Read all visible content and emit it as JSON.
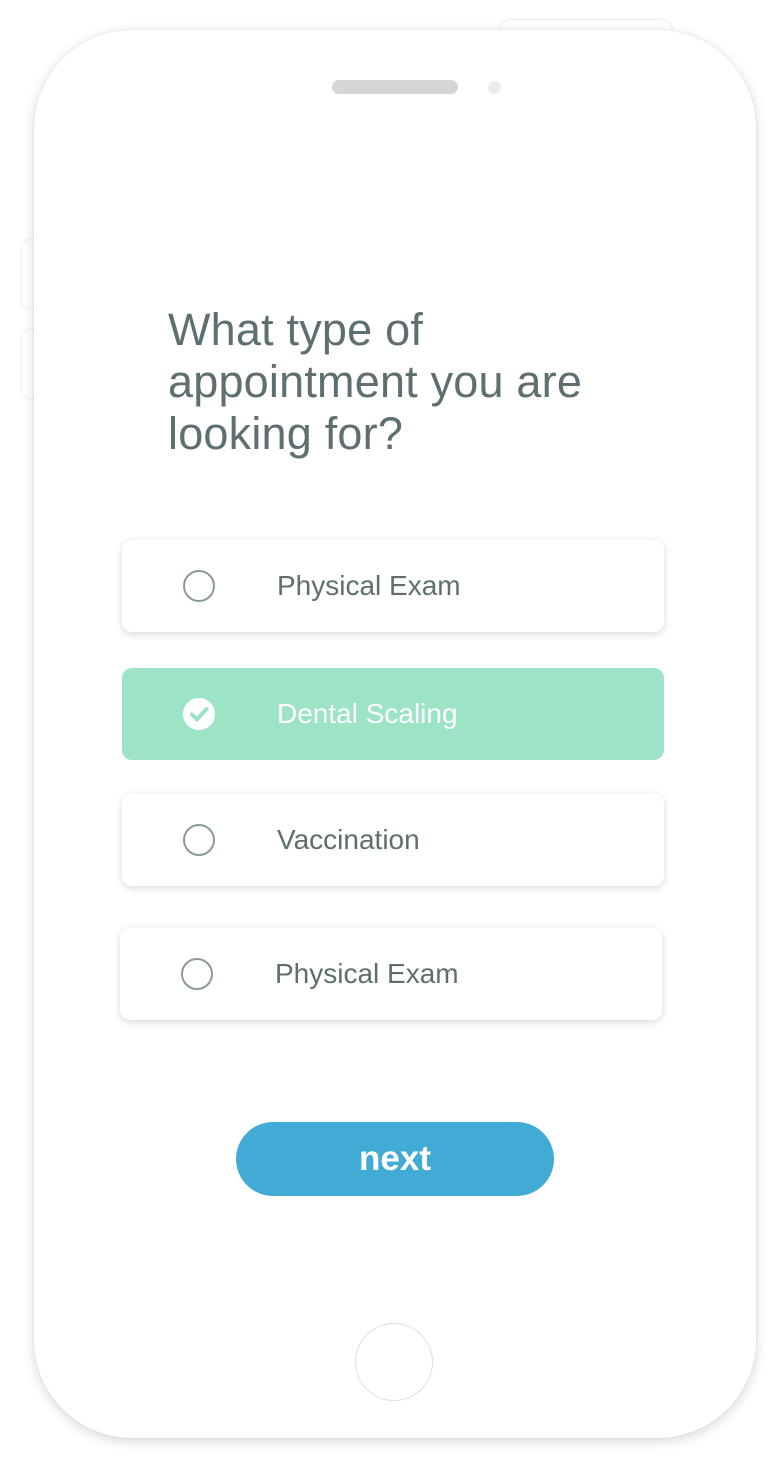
{
  "question": {
    "line1": "What type of",
    "line2": "appointment you are",
    "line3": "looking for?"
  },
  "options": [
    {
      "label": "Physical Exam",
      "selected": false
    },
    {
      "label": "Dental Scaling",
      "selected": true
    },
    {
      "label": "Vaccination",
      "selected": false
    },
    {
      "label": "Physical Exam",
      "selected": false
    }
  ],
  "next_button": {
    "label": "next"
  },
  "colors": {
    "selected_option": "#9de3c5",
    "primary_button": "#42abd5",
    "text": "#5d6f70",
    "radio_border": "#8a9a9a"
  },
  "icons": {
    "radio_unchecked": "circle-outline-icon",
    "radio_checked": "check-circle-icon"
  }
}
